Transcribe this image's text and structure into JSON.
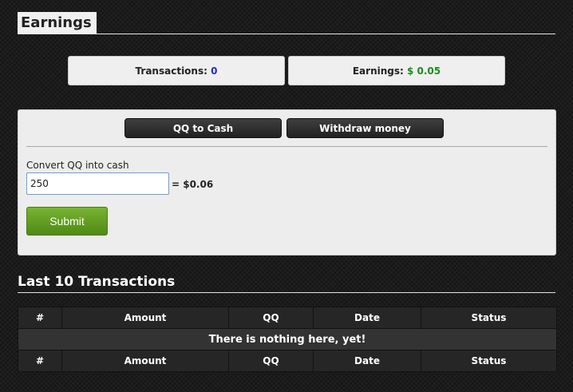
{
  "earnings_section": {
    "title": "Earnings"
  },
  "stats": {
    "transactions_label": "Transactions:",
    "transactions_value": "0",
    "earnings_label": "Earnings:",
    "earnings_value": "$ 0.05"
  },
  "tabs": {
    "qq_to_cash": "QQ to Cash",
    "withdraw": "Withdraw money"
  },
  "convert_form": {
    "label": "Convert QQ into cash",
    "input_value": "250",
    "result": "= $0.06",
    "submit_label": "Submit"
  },
  "transactions_section": {
    "title": "Last 10 Transactions",
    "columns": [
      "#",
      "Amount",
      "QQ",
      "Date",
      "Status"
    ],
    "empty_message": "There is nothing here, yet!"
  },
  "colors": {
    "transactions_value": "#1f2fc9",
    "earnings_value": "#1e8a1e",
    "submit_button": "#5f9c21"
  }
}
